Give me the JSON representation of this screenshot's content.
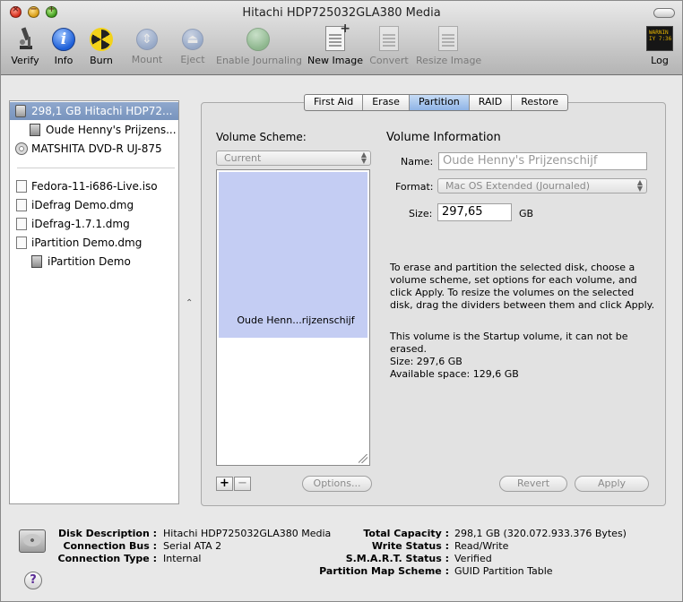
{
  "window": {
    "title": "Hitachi HDP725032GLA380 Media"
  },
  "toolbar": {
    "verify": "Verify",
    "info": "Info",
    "burn": "Burn",
    "mount": "Mount",
    "eject": "Eject",
    "enable_journaling": "Enable Journaling",
    "new_image": "New Image",
    "convert": "Convert",
    "resize_image": "Resize Image",
    "log": "Log",
    "log_icon_text": "WARNIN\nIY 7:36"
  },
  "sidebar": {
    "items": [
      {
        "label": "298,1 GB Hitachi HDP72...",
        "icon": "hard-disk-icon",
        "selected": true
      },
      {
        "label": "Oude Henny's Prijzens...",
        "icon": "volume-icon"
      },
      {
        "label": "MATSHITA DVD-R UJ-875",
        "icon": "optical-drive-icon"
      },
      {
        "label": "Fedora-11-i686-Live.iso",
        "icon": "disk-image-icon"
      },
      {
        "label": "iDefrag Demo.dmg",
        "icon": "disk-image-icon"
      },
      {
        "label": "iDefrag-1.7.1.dmg",
        "icon": "disk-image-icon"
      },
      {
        "label": "iPartition Demo.dmg",
        "icon": "disk-image-icon"
      },
      {
        "label": "iPartition Demo",
        "icon": "mounted-volume-icon"
      }
    ]
  },
  "tabs": [
    "First Aid",
    "Erase",
    "Partition",
    "RAID",
    "Restore"
  ],
  "active_tab": "Partition",
  "partition": {
    "scheme_label": "Volume Scheme:",
    "scheme_value": "Current",
    "volume_block_label": "Oude Henn...rijzenschijf",
    "info_label": "Volume Information",
    "name_label": "Name:",
    "name_value": "Oude Henny's Prijzenschijf",
    "format_label": "Format:",
    "format_value": "Mac OS Extended (Journaled)",
    "size_label": "Size:",
    "size_value": "297,65",
    "size_unit": "GB",
    "instructions": "To erase and partition the selected disk, choose a volume scheme, set options for each volume, and click Apply. To resize the volumes on the selected disk, drag the dividers between them and click Apply.",
    "startup_note": "This volume is the Startup volume, it can not be erased.",
    "size_line": "Size: 297,6 GB",
    "available_line": "Available space: 129,6 GB",
    "add": "+",
    "remove": "−",
    "options_button": "Options...",
    "revert_button": "Revert",
    "apply_button": "Apply"
  },
  "disk_info": {
    "left": [
      {
        "key": "Disk Description :",
        "value": "Hitachi HDP725032GLA380 Media"
      },
      {
        "key": "Connection Bus :",
        "value": "Serial ATA 2"
      },
      {
        "key": "Connection Type :",
        "value": "Internal"
      }
    ],
    "right": [
      {
        "key": "Total Capacity :",
        "value": "298,1 GB (320.072.933.376 Bytes)"
      },
      {
        "key": "Write Status :",
        "value": "Read/Write"
      },
      {
        "key": "S.M.A.R.T. Status :",
        "value": "Verified"
      },
      {
        "key": "Partition Map Scheme :",
        "value": "GUID Partition Table"
      }
    ]
  },
  "help": "?"
}
